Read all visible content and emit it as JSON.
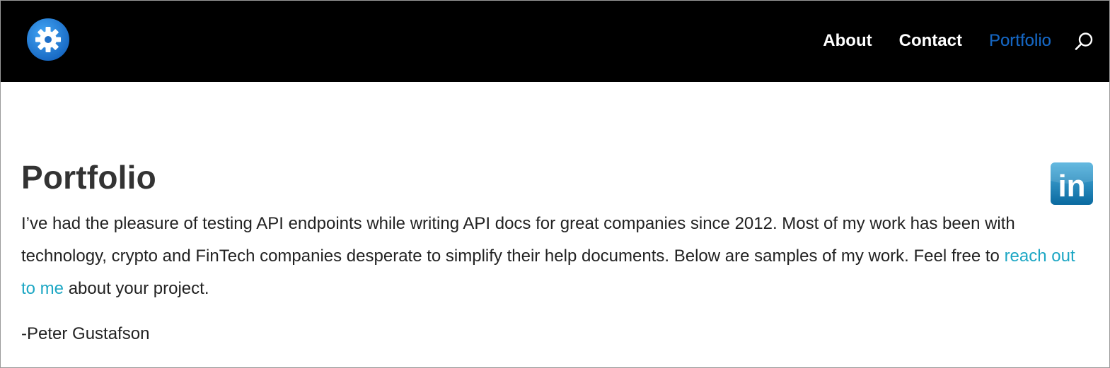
{
  "header": {
    "logo_icon": "gear-icon",
    "nav": [
      {
        "label": "About"
      },
      {
        "label": "Contact"
      },
      {
        "label": "Portfolio",
        "active": true
      }
    ],
    "search_icon": "search-icon"
  },
  "main": {
    "title": "Portfolio",
    "intro_before_link": "I’ve had the pleasure of testing API endpoints while writing API docs for great companies since 2012. Most of my work has been with technology, crypto and FinTech companies desperate to simplify their help documents. Below are samples of my work. Feel free to ",
    "intro_link": "reach out to me",
    "intro_after_link": " about your project.",
    "signature": "-Peter Gustafson"
  },
  "social": {
    "linkedin_text": "in",
    "linkedin_icon": "linkedin-icon"
  },
  "colors": {
    "header_bg": "#000000",
    "nav_active": "#1565c0",
    "link": "#1da7c4",
    "logo_blue": "#1e88e5",
    "linkedin_blue": "#0e76a8"
  }
}
